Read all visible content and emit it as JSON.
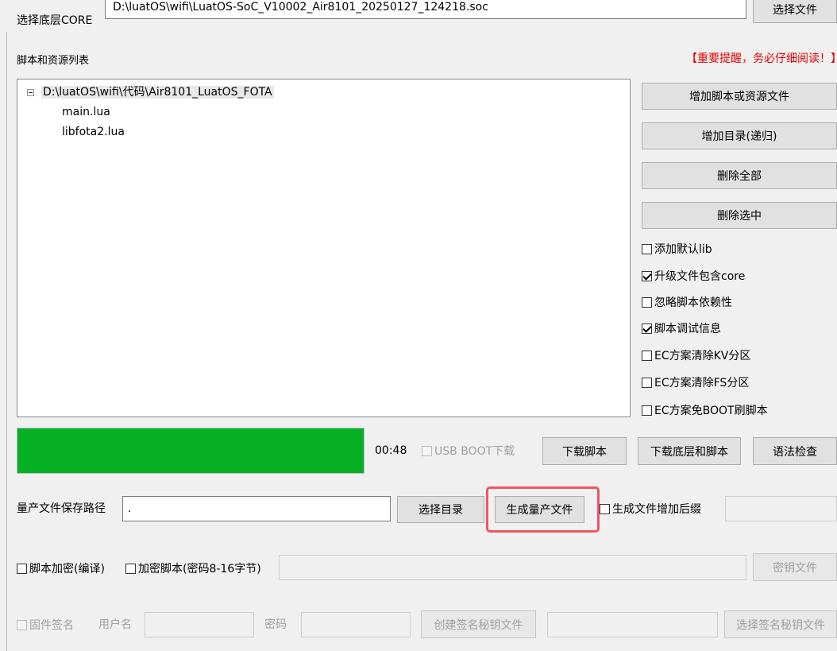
{
  "core": {
    "label": "选择底层CORE",
    "path": "D:\\luatOS\\wifi\\LuatOS-SoC_V10002_Air8101_20250127_124218.soc",
    "select_button": "选择文件"
  },
  "scripts": {
    "list_label": "脚本和资源列表",
    "warning": "【重要提醒，务必仔细阅读！】",
    "tree": {
      "root": "D:\\luatOS\\wifi\\代码\\Air8101_LuatOS_FOTA",
      "children": [
        "main.lua",
        "libfota2.lua"
      ]
    },
    "buttons": {
      "add_files": "增加脚本或资源文件",
      "add_dir": "增加目录(递归)",
      "delete_all": "删除全部",
      "delete_selected": "删除选中"
    },
    "options": [
      {
        "label": "添加默认lib",
        "checked": false
      },
      {
        "label": "升级文件包含core",
        "checked": true
      },
      {
        "label": "忽略脚本依赖性",
        "checked": false
      },
      {
        "label": "脚本调试信息",
        "checked": true
      },
      {
        "label": "EC方案清除KV分区",
        "checked": false
      },
      {
        "label": "EC方案清除FS分区",
        "checked": false
      },
      {
        "label": "EC方案免BOOT刷脚本",
        "checked": false
      }
    ]
  },
  "progress": {
    "value": 1.0,
    "color": "#06b025",
    "time": "00:48"
  },
  "download": {
    "usb_boot": "USB BOOT下载",
    "download_script": "下载脚本",
    "download_core_script": "下载底层和脚本",
    "syntax_check": "语法检查"
  },
  "mass": {
    "label": "量产文件保存路径",
    "path": ".",
    "select_dir": "选择目录",
    "generate": "生成量产文件",
    "suffix": "生成文件增加后缀",
    "highlight_color": "#ef5561"
  },
  "encrypt": {
    "compile": "脚本加密(编译)",
    "encrypt_script": "加密脚本(密码8-16字节)",
    "key_file": "密钥文件"
  },
  "sign": {
    "firmware_sign": "固件签名",
    "username": "用户名",
    "password": "密码",
    "create_key": "创建签名秘钥文件",
    "select_key": "选择签名秘钥文件"
  }
}
